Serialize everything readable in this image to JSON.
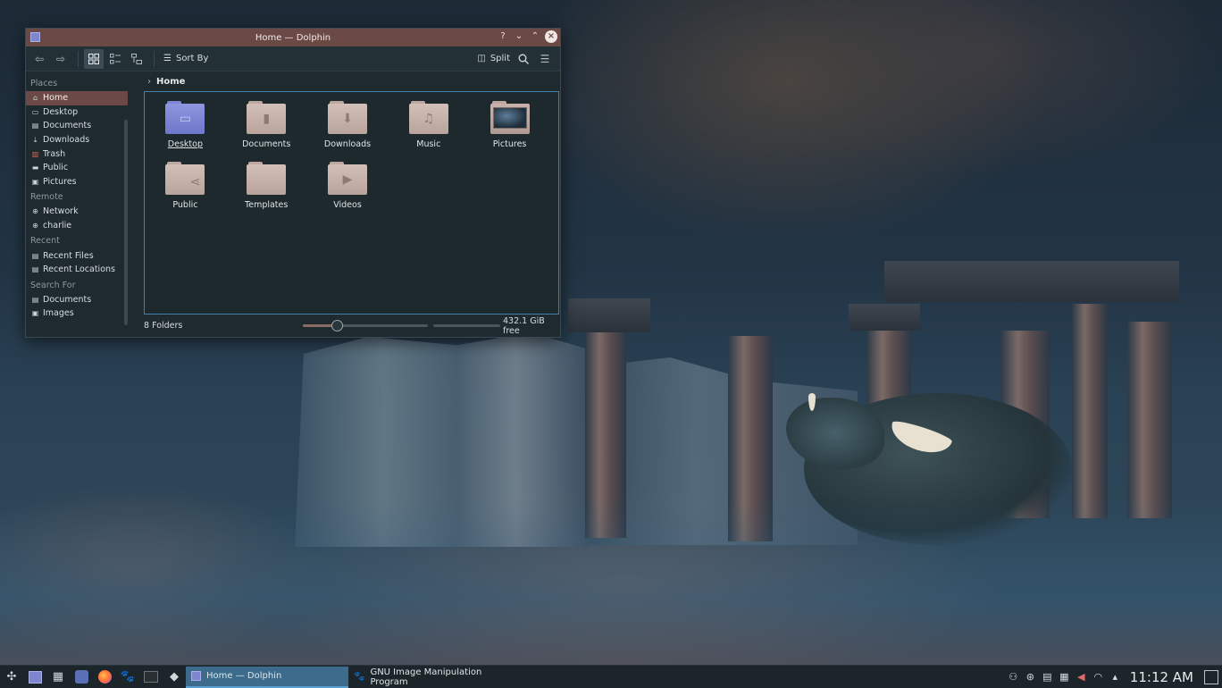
{
  "window": {
    "title": "Home — Dolphin",
    "help_glyph": "?",
    "min_glyph": "⌄",
    "max_glyph": "⌃",
    "close_glyph": "×"
  },
  "toolbar": {
    "sort_by_label": "Sort By",
    "split_label": "Split"
  },
  "sidebar": {
    "places_header": "Places",
    "places": [
      {
        "label": "Home",
        "icon": "home-icon",
        "active": true
      },
      {
        "label": "Desktop",
        "icon": "desktop-icon"
      },
      {
        "label": "Documents",
        "icon": "document-icon"
      },
      {
        "label": "Downloads",
        "icon": "download-icon"
      },
      {
        "label": "Trash",
        "icon": "trash-icon"
      },
      {
        "label": "Public",
        "icon": "folder-icon"
      },
      {
        "label": "Pictures",
        "icon": "picture-icon"
      }
    ],
    "remote_header": "Remote",
    "remote": [
      {
        "label": "Network",
        "icon": "network-icon"
      },
      {
        "label": "charlie",
        "icon": "network-icon"
      }
    ],
    "recent_header": "Recent",
    "recent": [
      {
        "label": "Recent Files",
        "icon": "document-icon"
      },
      {
        "label": "Recent Locations",
        "icon": "document-icon"
      }
    ],
    "search_header": "Search For",
    "search": [
      {
        "label": "Documents",
        "icon": "document-icon"
      },
      {
        "label": "Images",
        "icon": "picture-icon"
      }
    ]
  },
  "breadcrumb": {
    "current": "Home"
  },
  "folders": [
    {
      "label": "Desktop",
      "icon": "desktop-folder-icon"
    },
    {
      "label": "Documents",
      "icon": "documents-folder-icon"
    },
    {
      "label": "Downloads",
      "icon": "downloads-folder-icon"
    },
    {
      "label": "Music",
      "icon": "music-folder-icon"
    },
    {
      "label": "Pictures",
      "icon": "pictures-folder-icon"
    },
    {
      "label": "Public",
      "icon": "public-folder-icon"
    },
    {
      "label": "Templates",
      "icon": "templates-folder-icon"
    },
    {
      "label": "Videos",
      "icon": "videos-folder-icon"
    }
  ],
  "status": {
    "count": "8 Folders",
    "free_space": "432.1 GiB free",
    "zoom_fraction": 0.27,
    "space_used_fraction": 0.0
  },
  "taskbar": {
    "tasks": [
      {
        "label": "Home — Dolphin",
        "active": true
      },
      {
        "label": "GNU Image Manipulation Program",
        "active": false
      }
    ],
    "clock": "11:12 AM"
  },
  "colors": {
    "accent": "#6b4a46",
    "selection_border": "#3f82b2",
    "task_active": "#3c6b8c"
  }
}
